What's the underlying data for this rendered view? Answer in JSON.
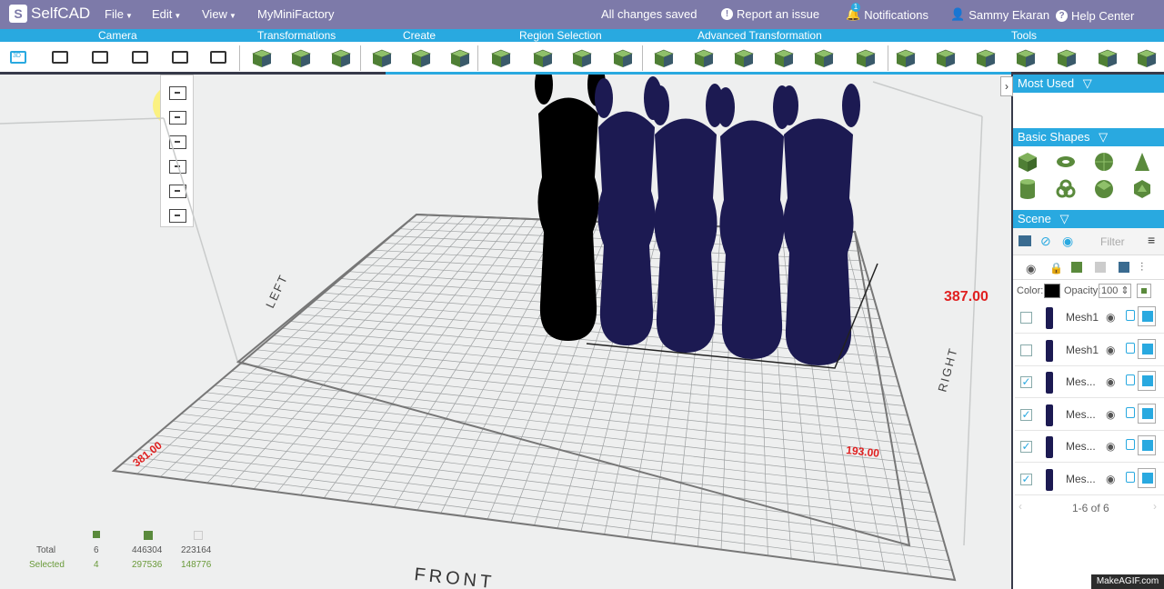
{
  "app": {
    "logo": "SelfCAD"
  },
  "topbar": {
    "menus": [
      "File",
      "Edit",
      "View"
    ],
    "mini_factory": "MyMiniFactory",
    "status": "All changes saved",
    "report": "Report an issue",
    "notifications": "Notifications",
    "notification_count": "1",
    "user": "Sammy Ekaran",
    "help": "Help Center"
  },
  "categories": [
    "Camera",
    "Transformations",
    "Create",
    "Region Selection",
    "Advanced Transformation",
    "Tools"
  ],
  "camera_first_label": "3D",
  "viewport_labels": {
    "left": "LEFT",
    "right": "RIGHT",
    "front": "FRONT",
    "dim_x": "381.00",
    "dim_y": "193.00",
    "dim_z": "387.00"
  },
  "panel": {
    "most_used": "Most Used",
    "basic_shapes": "Basic Shapes",
    "scene": "Scene",
    "filter_placeholder": "Filter",
    "color_label": "Color:",
    "opacity_label": "Opacity:",
    "opacity_value": "100",
    "pager": "1-6 of 6",
    "meshes": [
      {
        "name": "Mesh1",
        "checked": false
      },
      {
        "name": "Mesh1",
        "checked": false
      },
      {
        "name": "Mes...",
        "checked": true
      },
      {
        "name": "Mes...",
        "checked": true
      },
      {
        "name": "Mes...",
        "checked": true
      },
      {
        "name": "Mes...",
        "checked": true
      }
    ]
  },
  "stats": {
    "total_label": "Total",
    "selected_label": "Selected",
    "total": [
      "6",
      "446304",
      "223164"
    ],
    "selected": [
      "4",
      "297536",
      "148776"
    ]
  },
  "watermark": "MakeAGIF.com",
  "colors": {
    "header": "#7d7aa9",
    "accent": "#29a9e0",
    "model": "#1c1a52",
    "selected_model": "#000000",
    "dims": "#e02020"
  }
}
